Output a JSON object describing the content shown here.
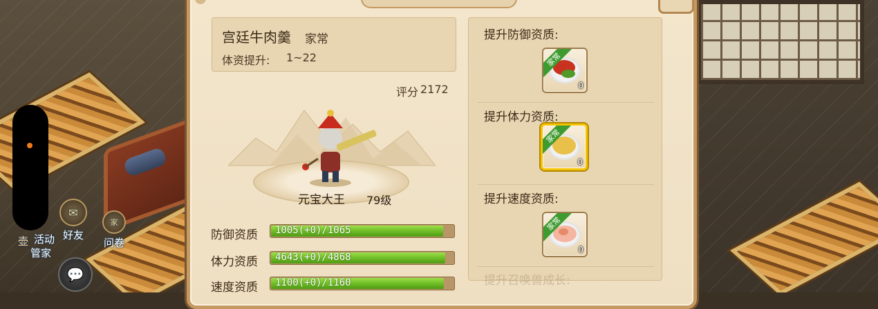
{
  "food": {
    "name": "宫廷牛肉羹",
    "type": "家常",
    "bonus_label": "体资提升:",
    "bonus_range": "1~22"
  },
  "pet": {
    "score_label": "评分",
    "score_value": "2172",
    "name": "元宝大王",
    "level": "79级"
  },
  "stats": [
    {
      "label": "防御资质",
      "text": "1005(+0)/1065",
      "current": 1005,
      "max": 1065
    },
    {
      "label": "体力资质",
      "text": "4643(+0)/4868",
      "current": 4643,
      "max": 4868
    },
    {
      "label": "速度资质",
      "text": "1100(+0)/1160",
      "current": 1100,
      "max": 1160
    }
  ],
  "sections": [
    {
      "label": "提升防御资质:",
      "item_tag": "家常",
      "qty": "0",
      "dish": "braised-pork-icon",
      "selected": false
    },
    {
      "label": "提升体力资质:",
      "item_tag": "家常",
      "qty": "0",
      "dish": "noodle-dish-icon",
      "selected": true
    },
    {
      "label": "提升速度资质:",
      "item_tag": "家常",
      "qty": "0",
      "dish": "shrimp-dish-icon",
      "selected": false
    }
  ],
  "next_section_label": "提升召唤兽成长:",
  "side_buttons": {
    "activity_label": "活动",
    "friends_label": "好友",
    "survey_label": "问卷",
    "survey_badge": "家",
    "butler_label": "管家",
    "red_label": "壶"
  },
  "colors": {
    "panel_bg": "#efdfc2",
    "bar_fill": "#6cbb25",
    "selected_border": "#f5c400",
    "tag_green": "#3e9b2f"
  }
}
